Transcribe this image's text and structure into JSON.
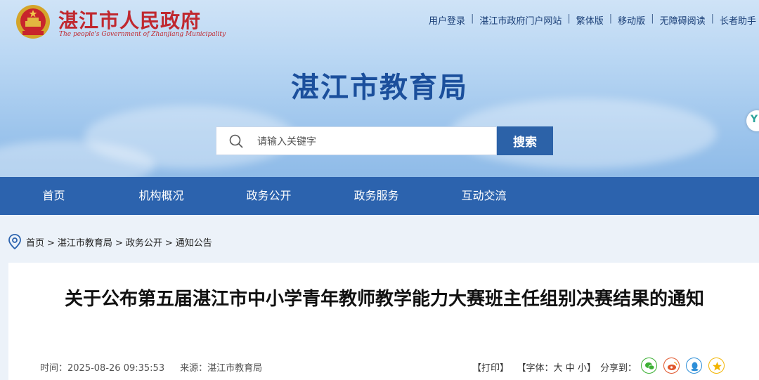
{
  "header": {
    "gov_name": "湛江市人民政府",
    "gov_name_en": "The people's Government of Zhanjiang Municipality",
    "top_links": [
      "用户登录",
      "湛江市政府门户网站",
      "繁体版",
      "移动版",
      "无障碍阅读",
      "长者助手"
    ],
    "site_title": "湛江市教育局"
  },
  "search": {
    "placeholder": "请输入关键字",
    "button": "搜索"
  },
  "side_tab": {
    "label": "Y"
  },
  "nav": [
    "首页",
    "机构概况",
    "政务公开",
    "政务服务",
    "互动交流"
  ],
  "breadcrumb": [
    "首页",
    "湛江市教育局",
    "政务公开",
    "通知公告"
  ],
  "article": {
    "title": "关于公布第五届湛江市中小学青年教师教学能力大赛班主任组别决赛结果的通知",
    "time_label": "时间：",
    "time": "2025-08-26 09:35:53",
    "source_label": "来源：",
    "source": "湛江市教育局",
    "print": "【打印】",
    "font_label": "【字体：",
    "font_large": "大",
    "font_medium": "中",
    "font_small": "小",
    "font_close": "】",
    "share_label": "分享到："
  },
  "colors": {
    "brand": "#2c63ae",
    "gov_red": "#c0282f",
    "title_blue": "#1b4f9c"
  },
  "share_icons": [
    "wechat-icon",
    "weibo-icon",
    "qq-icon",
    "qzone-icon"
  ]
}
